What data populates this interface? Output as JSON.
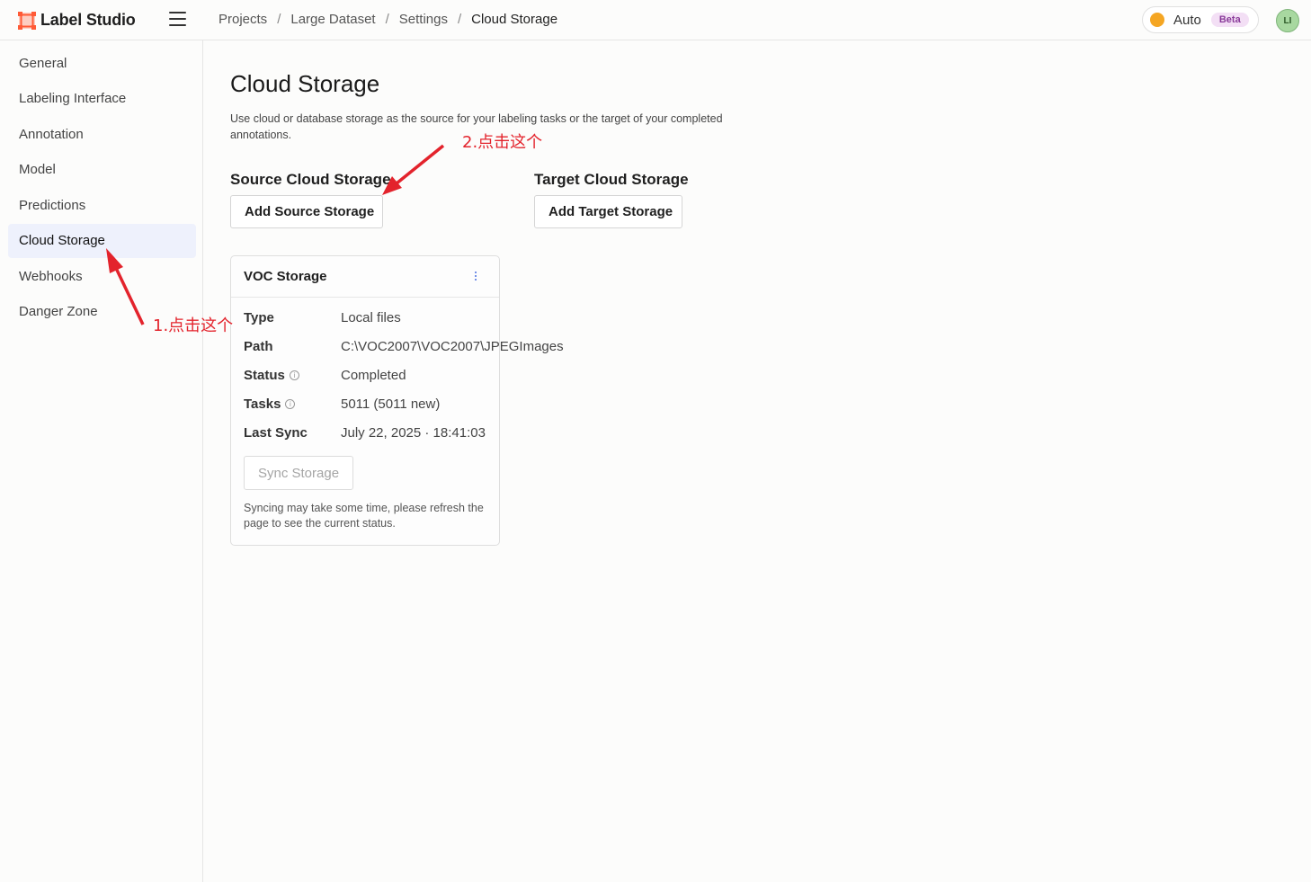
{
  "app": {
    "name": "Label Studio"
  },
  "breadcrumb": [
    "Projects",
    "Large Dataset",
    "Settings",
    "Cloud Storage"
  ],
  "theme": {
    "label": "Auto",
    "badge": "Beta"
  },
  "user": {
    "initials": "LI"
  },
  "sidebar": {
    "items": [
      {
        "label": "General"
      },
      {
        "label": "Labeling Interface"
      },
      {
        "label": "Annotation"
      },
      {
        "label": "Model"
      },
      {
        "label": "Predictions"
      },
      {
        "label": "Cloud Storage"
      },
      {
        "label": "Webhooks"
      },
      {
        "label": "Danger Zone"
      }
    ],
    "active_index": 5
  },
  "main": {
    "title": "Cloud Storage",
    "description": "Use cloud or database storage as the source for your labeling tasks or the target of your completed annotations.",
    "source": {
      "title": "Source Cloud Storage",
      "button": "Add Source Storage"
    },
    "target": {
      "title": "Target Cloud Storage",
      "button": "Add Target Storage"
    }
  },
  "storage_card": {
    "name": "VOC Storage",
    "fields": [
      {
        "key": "Type",
        "value": "Local files",
        "info": false
      },
      {
        "key": "Path",
        "value": "C:\\VOC2007\\VOC2007\\JPEGImages",
        "info": false
      },
      {
        "key": "Status",
        "value": "Completed",
        "info": true
      },
      {
        "key": "Tasks",
        "value": "5011 (5011 new)",
        "info": true
      },
      {
        "key": "Last Sync",
        "value": "July 22, 2025 · 18:41:03",
        "info": false
      }
    ],
    "sync_button": "Sync Storage",
    "sync_note": "Syncing may take some time, please refresh the page to see the current status."
  },
  "annotations": {
    "step1": "1.点击这个",
    "step2": "2.点击这个"
  },
  "colors": {
    "annotation": "#e3232c",
    "accent": "#4a6ee0",
    "active_bg": "#eef1fc"
  }
}
